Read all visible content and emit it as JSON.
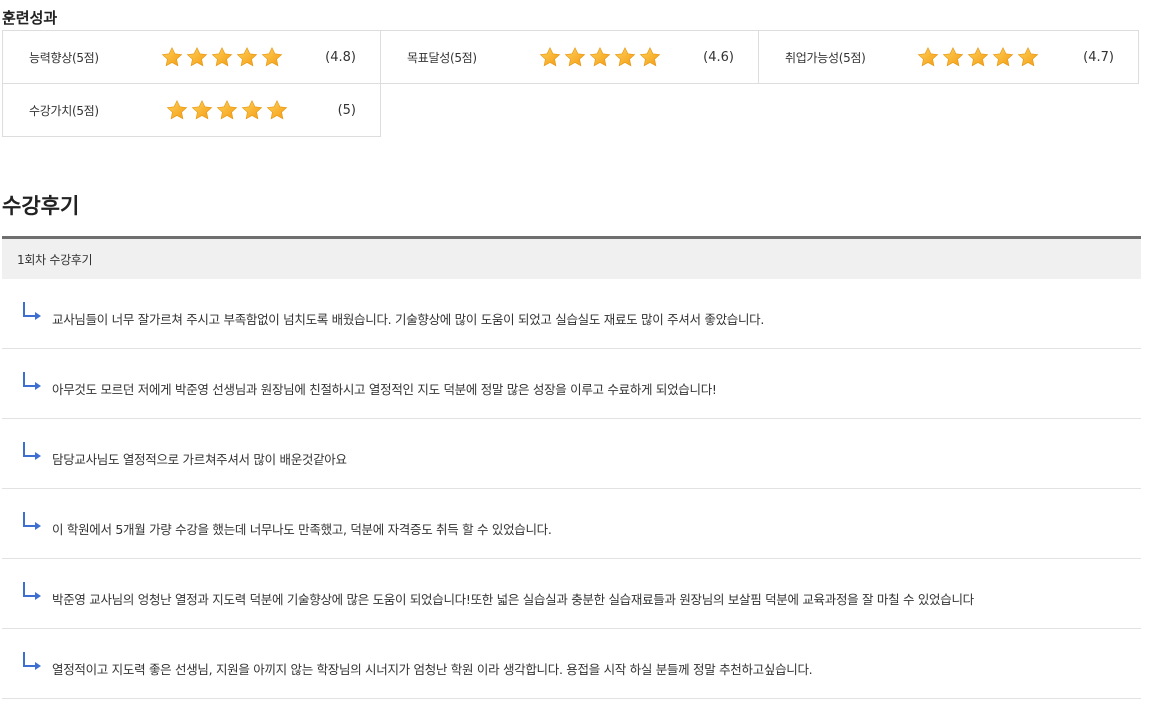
{
  "training_results": {
    "title": "훈련성과",
    "items": [
      {
        "label": "능력향상(5점)",
        "score": "(4.8)",
        "rating": 4.8
      },
      {
        "label": "목표달성(5점)",
        "score": "(4.6)",
        "rating": 4.6
      },
      {
        "label": "취업가능성(5점)",
        "score": "(4.7)",
        "rating": 4.7
      },
      {
        "label": "수강가치(5점)",
        "score": "(5)",
        "rating": 5
      }
    ]
  },
  "reviews": {
    "title": "수강후기",
    "round_label": "1회차 수강후기",
    "items": [
      {
        "text": "교사님들이 너무 잘가르쳐 주시고 부족함없이 넘치도록 배웠습니다. 기술향상에 많이 도움이 되었고 실습실도 재료도 많이 주셔서 좋았습니다."
      },
      {
        "text": "아무것도 모르던 저에게 박준영 선생님과 원장님에 친절하시고 열정적인 지도 덕분에 정말 많은 성장을 이루고 수료하게 되었습니다!"
      },
      {
        "text": "담당교사님도 열정적으로 가르쳐주셔서 많이 배운것같아요"
      },
      {
        "text": "이 학원에서 5개월 가량 수강을 했는데 너무나도 만족했고, 덕분에 자격증도 취득 할 수 있었습니다."
      },
      {
        "text": "박준영 교사님의 엉청난 열정과 지도력 덕분에 기술향상에 많은 도움이 되었습니다!또한 넓은 실습실과 충분한 실습재료들과 원장님의 보살핌 덕분에 교육과정을 잘 마칠 수 있었습니다"
      },
      {
        "text": " 열정적이고 지도력 좋은 선생님, 지원을 아끼지 않는 학장님의 시너지가 엄청난 학원 이라 생각합니다. 용접을 시작 하실 분들께 정말 추천하고싶습니다."
      }
    ]
  },
  "colors": {
    "star_gold": "#f5b21b",
    "star_orange": "#f39a12",
    "arrow_blue": "#3d6fd1",
    "header_bar": "#6f6f6f"
  },
  "icons": {
    "star": "star-icon",
    "reply_arrow": "reply-arrow-icon"
  }
}
